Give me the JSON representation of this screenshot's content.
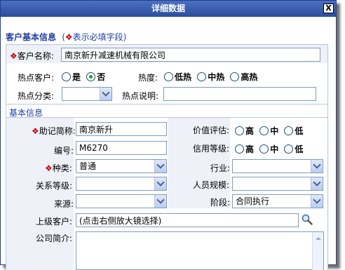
{
  "window": {
    "title": "详细数据",
    "close_label": "X"
  },
  "section": {
    "title": "客户基本信息",
    "required_note_star": "❖",
    "required_note": "表示必填字段",
    "note_open": "(",
    "note_close": ")"
  },
  "customer": {
    "name_star": "❖",
    "name_label": "客户名称:",
    "name_value": "南京新升减速机械有限公司"
  },
  "hot": {
    "customer_label": "热点客户:",
    "customer_options": [
      "是",
      "否"
    ],
    "customer_selected": "否",
    "degree_label": "热度:",
    "degree_options": [
      "低热",
      "中热",
      "高热"
    ],
    "category_label": "热点分类:",
    "category_value": "",
    "desc_label": "热点说明:",
    "desc_value": ""
  },
  "basic": {
    "title": "基本信息",
    "alias_star": "❖",
    "alias_label": "助记简称:",
    "alias_value": "南京新升",
    "number_label": "编号:",
    "number_value": "M6270",
    "type_star": "❖",
    "type_label": "种类:",
    "type_value": "普通",
    "relation_label": "关系等级:",
    "relation_value": "",
    "source_label": "来源:",
    "source_value": "",
    "parent_label": "上级客户:",
    "parent_value": "(点击右侧放大镜选择)",
    "intro_label": "公司简介:",
    "value_label": "价值评估:",
    "value_options": [
      "高",
      "中",
      "低"
    ],
    "credit_label": "信用等级:",
    "credit_options": [
      "高",
      "中",
      "低"
    ],
    "industry_label": "行业:",
    "industry_value": "",
    "staff_label": "人员规模:",
    "staff_value": "",
    "stage_label": "阶段:",
    "stage_value": "合同执行"
  },
  "icons": {
    "close": "close-icon",
    "magnifier": "magnifier-icon",
    "dropdown": "chevron-down-icon"
  }
}
